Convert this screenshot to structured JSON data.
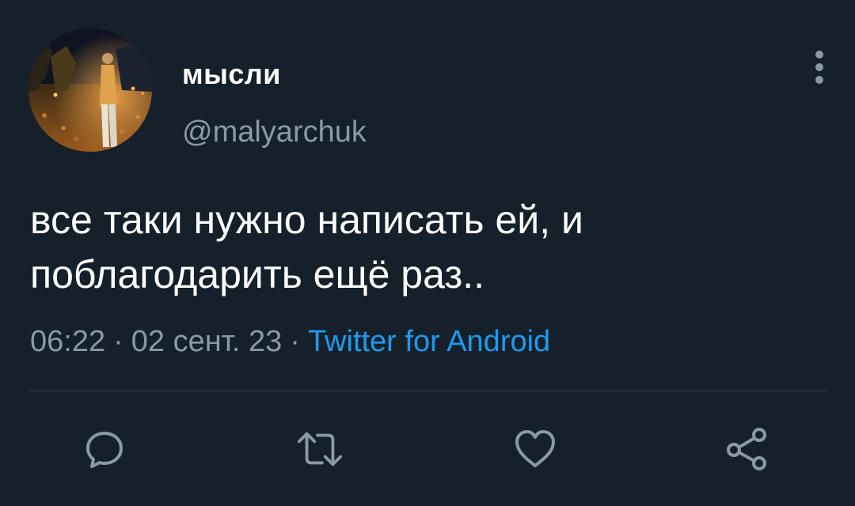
{
  "user": {
    "display_name": "мысли",
    "handle": "@malyarchuk",
    "avatar_icon": "profile-photo"
  },
  "tweet": {
    "text": "все таки нужно написать ей, и\nпоблагодарить ещё раз..",
    "time": "06:22",
    "date": "02 сент. 23",
    "separator": "·",
    "source": "Twitter for Android"
  },
  "actions": {
    "reply_icon": "reply-icon",
    "retweet_icon": "retweet-icon",
    "like_icon": "heart-icon",
    "share_icon": "share-icon",
    "more_icon": "more-vertical-icon"
  },
  "colors": {
    "background": "#15202b",
    "text_primary": "#ffffff",
    "text_secondary": "#8b98a5",
    "accent": "#1d9bf0",
    "divider": "#38444d"
  }
}
